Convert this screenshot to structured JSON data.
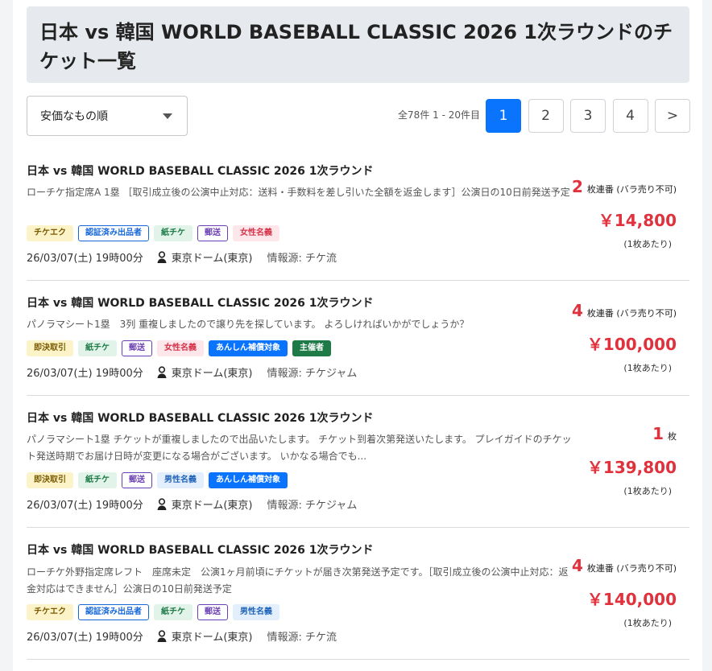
{
  "page_title": "日本 vs 韓国 WORLD BASEBALL CLASSIC 2026 1次ラウンドのチケット一覧",
  "sort": {
    "label": "安価なもの順"
  },
  "result_count": "全78件 1 - 20件目",
  "pagination": {
    "pages": [
      "1",
      "2",
      "3",
      "4"
    ],
    "active": "1",
    "next": ">"
  },
  "listings": [
    {
      "title": "日本 vs 韓国 WORLD BASEBALL CLASSIC 2026 1次ラウンド",
      "description": "ローチケ指定席A 1塁 ［取引成立後の公演中止対応：送料・手数料を差し引いた全額を返金します］公演日の10日前発送予定",
      "tags": [
        "チケエク",
        "認証済み出品者",
        "紙チケ",
        "郵送",
        "女性名義"
      ],
      "datetime": "26/03/07(土) 19時00分",
      "venue": "東京ドーム(東京)",
      "source": "情報源: チケ流",
      "quantity": "2",
      "quantity_unit": "枚連番 (バラ売り不可)",
      "price": "￥14,800",
      "per": "(1枚あたり)"
    },
    {
      "title": "日本 vs 韓国 WORLD BASEBALL CLASSIC 2026 1次ラウンド",
      "description": "パノラマシート1塁　3列 重複しましたので譲り先を探しています。 よろしければいかがでしょうか？",
      "tags": [
        "即決取引",
        "紙チケ",
        "郵送",
        "女性名義",
        "あんしん補償対象",
        "主催者"
      ],
      "datetime": "26/03/07(土) 19時00分",
      "venue": "東京ドーム(東京)",
      "source": "情報源: チケジャム",
      "quantity": "4",
      "quantity_unit": "枚連番 (バラ売り不可)",
      "price": "￥100,000",
      "per": "(1枚あたり)"
    },
    {
      "title": "日本 vs 韓国 WORLD BASEBALL CLASSIC 2026 1次ラウンド",
      "description": "パノラマシート1塁 チケットが重複しましたので出品いたします。 チケット到着次第発送いたします。 プレイガイドのチケット発送時期でお届け日時が変更になる場合がございます。 いかなる場合でも...",
      "tags": [
        "即決取引",
        "紙チケ",
        "郵送",
        "男性名義",
        "あんしん補償対象"
      ],
      "datetime": "26/03/07(土) 19時00分",
      "venue": "東京ドーム(東京)",
      "source": "情報源: チケジャム",
      "quantity": "1",
      "quantity_unit": "枚",
      "price": "￥139,800",
      "per": "(1枚あたり)"
    },
    {
      "title": "日本 vs 韓国 WORLD BASEBALL CLASSIC 2026 1次ラウンド",
      "description": "ローチケ外野指定席レフト　座席未定　公演1ヶ月前頃にチケットが届き次第発送予定です。［取引成立後の公演中止対応：返金対応はできません］公演日の10日前発送予定",
      "tags": [
        "チケエク",
        "認証済み出品者",
        "紙チケ",
        "郵送",
        "男性名義"
      ],
      "datetime": "26/03/07(土) 19時00分",
      "venue": "東京ドーム(東京)",
      "source": "情報源: チケ流",
      "quantity": "4",
      "quantity_unit": "枚連番 (バラ売り不可)",
      "price": "￥140,000",
      "per": "(1枚あたり)"
    }
  ]
}
